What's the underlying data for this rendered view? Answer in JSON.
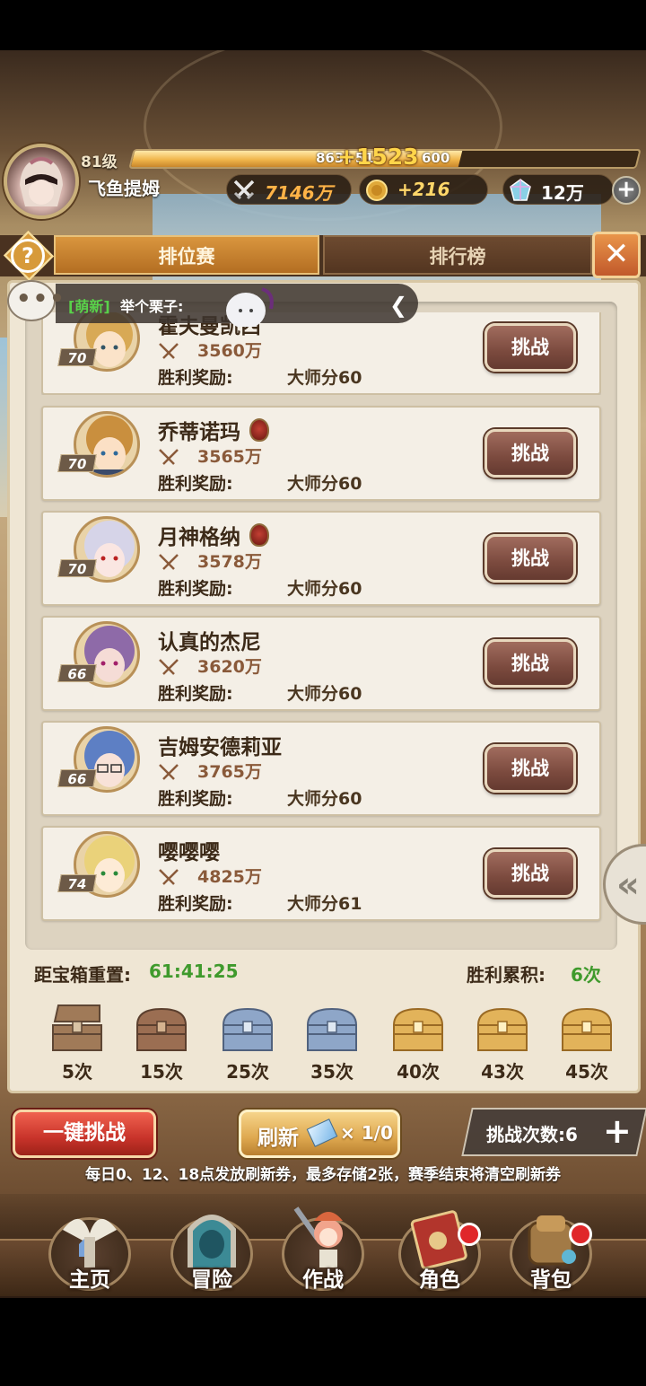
{
  "player": {
    "level": "81级",
    "name": "飞鱼提姆",
    "xp_text": "863+51",
    "xp_gain": "+1523",
    "xp_max": "600",
    "xp_fill": 0.65,
    "power": "7146万",
    "gold": "+216",
    "gems": "12万"
  },
  "tabs": [
    {
      "label": "排位赛",
      "active": true
    },
    {
      "label": "排行榜",
      "active": false
    }
  ],
  "chat": {
    "tag": "[萌新]",
    "text": "举个栗子:"
  },
  "opponents": [
    {
      "name": "霍夫曼凯西",
      "level": "70",
      "power": "3560万",
      "reward_label": "胜利奖励:",
      "reward": "大师分60",
      "action": "挑战",
      "shield": false
    },
    {
      "name": "乔蒂诺玛",
      "level": "70",
      "power": "3565万",
      "reward_label": "胜利奖励:",
      "reward": "大师分60",
      "action": "挑战",
      "shield": true
    },
    {
      "name": "月神格纳",
      "level": "70",
      "power": "3578万",
      "reward_label": "胜利奖励:",
      "reward": "大师分60",
      "action": "挑战",
      "shield": true
    },
    {
      "name": "认真的杰尼",
      "level": "66",
      "power": "3620万",
      "reward_label": "胜利奖励:",
      "reward": "大师分60",
      "action": "挑战",
      "shield": false
    },
    {
      "name": "吉姆安德莉亚",
      "level": "66",
      "power": "3765万",
      "reward_label": "胜利奖励:",
      "reward": "大师分60",
      "action": "挑战",
      "shield": false
    },
    {
      "name": "嘤嘤嘤",
      "level": "74",
      "power": "4825万",
      "reward_label": "胜利奖励:",
      "reward": "大师分61",
      "action": "挑战",
      "shield": false
    }
  ],
  "chest_reset": {
    "label": "距宝箱重置:",
    "timer": "61:41:25"
  },
  "wins": {
    "label": "胜利累积:",
    "value": "6次"
  },
  "chests": [
    {
      "label": "5次",
      "type": "opened"
    },
    {
      "label": "15次",
      "type": "wood"
    },
    {
      "label": "25次",
      "type": "silver"
    },
    {
      "label": "35次",
      "type": "silver"
    },
    {
      "label": "40次",
      "type": "gold"
    },
    {
      "label": "43次",
      "type": "gold"
    },
    {
      "label": "45次",
      "type": "gold"
    }
  ],
  "actions": {
    "one_click": "一键挑战",
    "refresh": "刷新",
    "refresh_count": "× 1/0",
    "attempts": "挑战次数:6"
  },
  "notice": "每日0、12、18点发放刷新券，最多存储2张，赛季结束将清空刷新券",
  "nav": [
    "主页",
    "冒险",
    "作战",
    "角色",
    "背包"
  ],
  "colors": {
    "accent_green": "#3f9a2c",
    "challenge_button": "#7b4a3e",
    "active_tab": "#c9832d"
  }
}
